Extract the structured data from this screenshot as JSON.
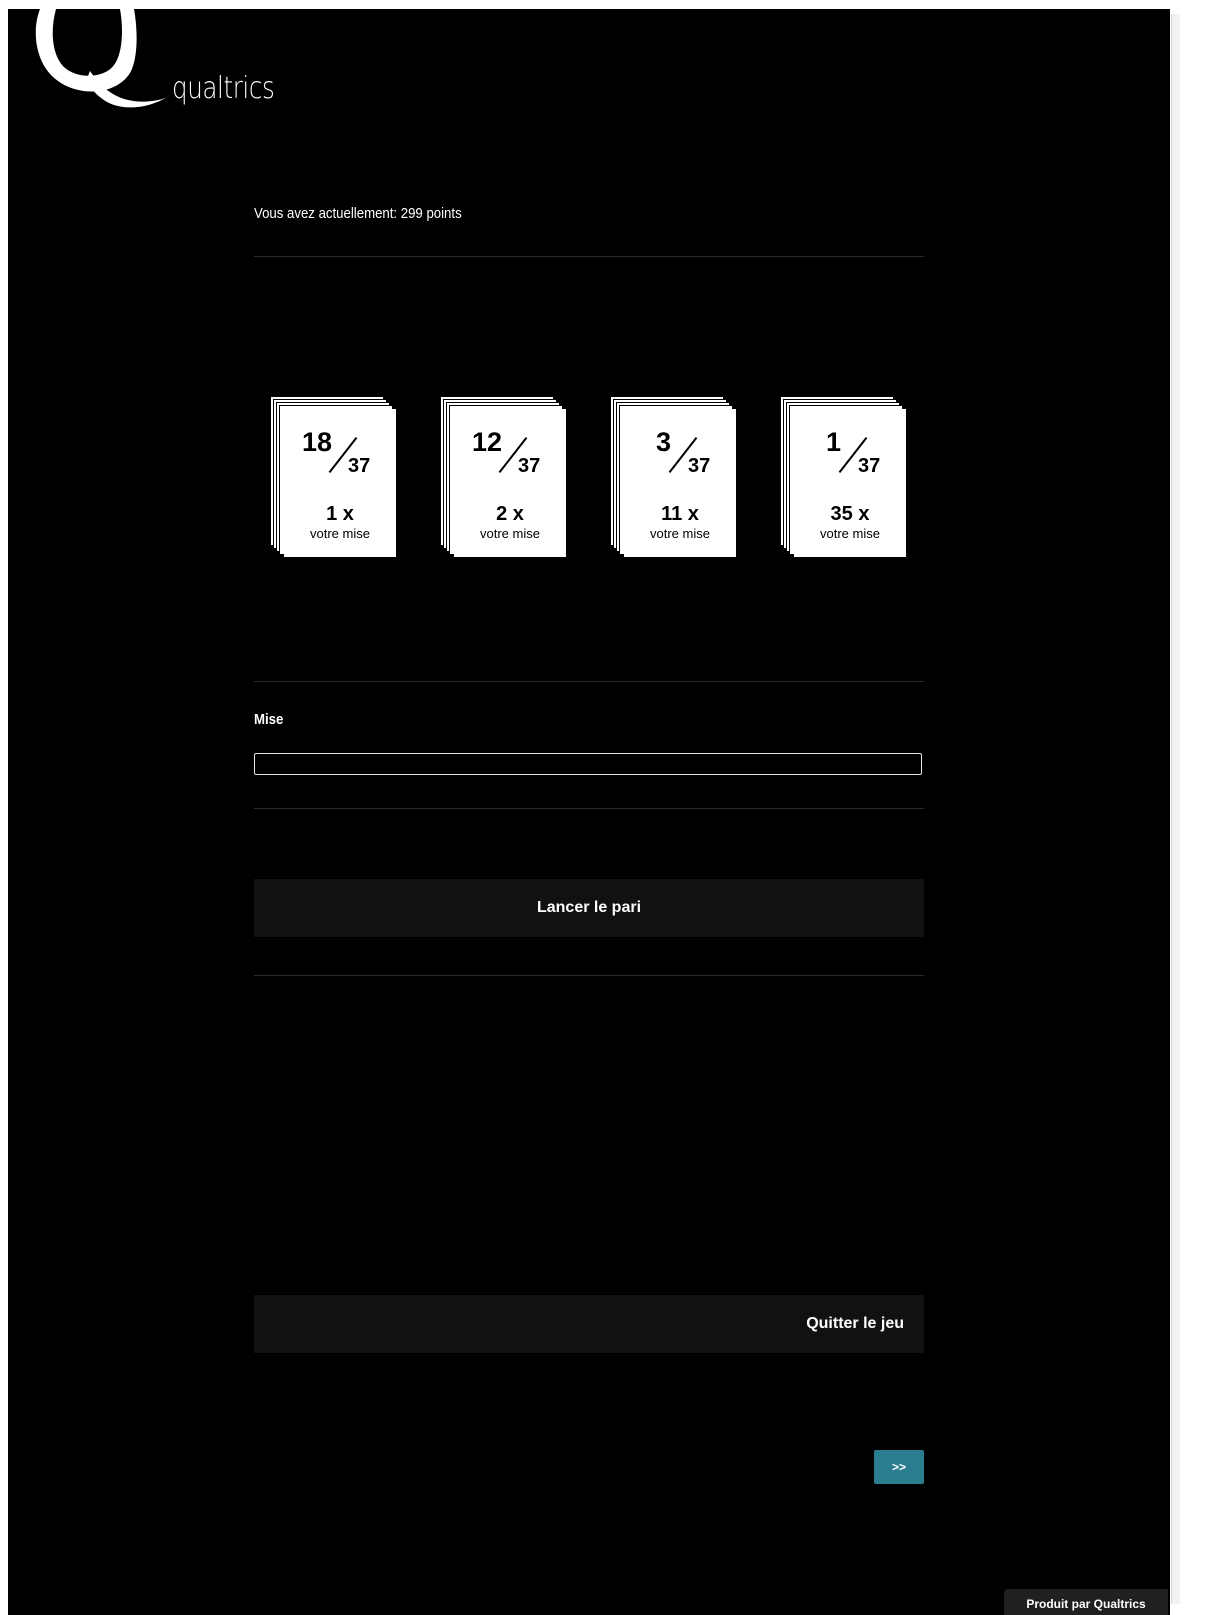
{
  "brand": {
    "name": "qualtrics",
    "footer": "Produit par Qualtrics"
  },
  "game": {
    "points_text": "Vous avez actuellement: 299 points",
    "cards": [
      {
        "numerator": "18",
        "denominator": "37",
        "multiplier": "1 x",
        "caption": "votre mise"
      },
      {
        "numerator": "12",
        "denominator": "37",
        "multiplier": "2 x",
        "caption": "votre mise"
      },
      {
        "numerator": "3",
        "denominator": "37",
        "multiplier": "11 x",
        "caption": "votre mise"
      },
      {
        "numerator": "1",
        "denominator": "37",
        "multiplier": "35 x",
        "caption": "votre mise"
      }
    ],
    "stake_label": "Mise",
    "stake_value": "",
    "bet_button": "Lancer le pari",
    "quit_button": "Quitter le jeu",
    "next_button": ">>"
  },
  "colors": {
    "background": "#000000",
    "next_button": "#2a7d8f",
    "button_bar": "#111111"
  }
}
